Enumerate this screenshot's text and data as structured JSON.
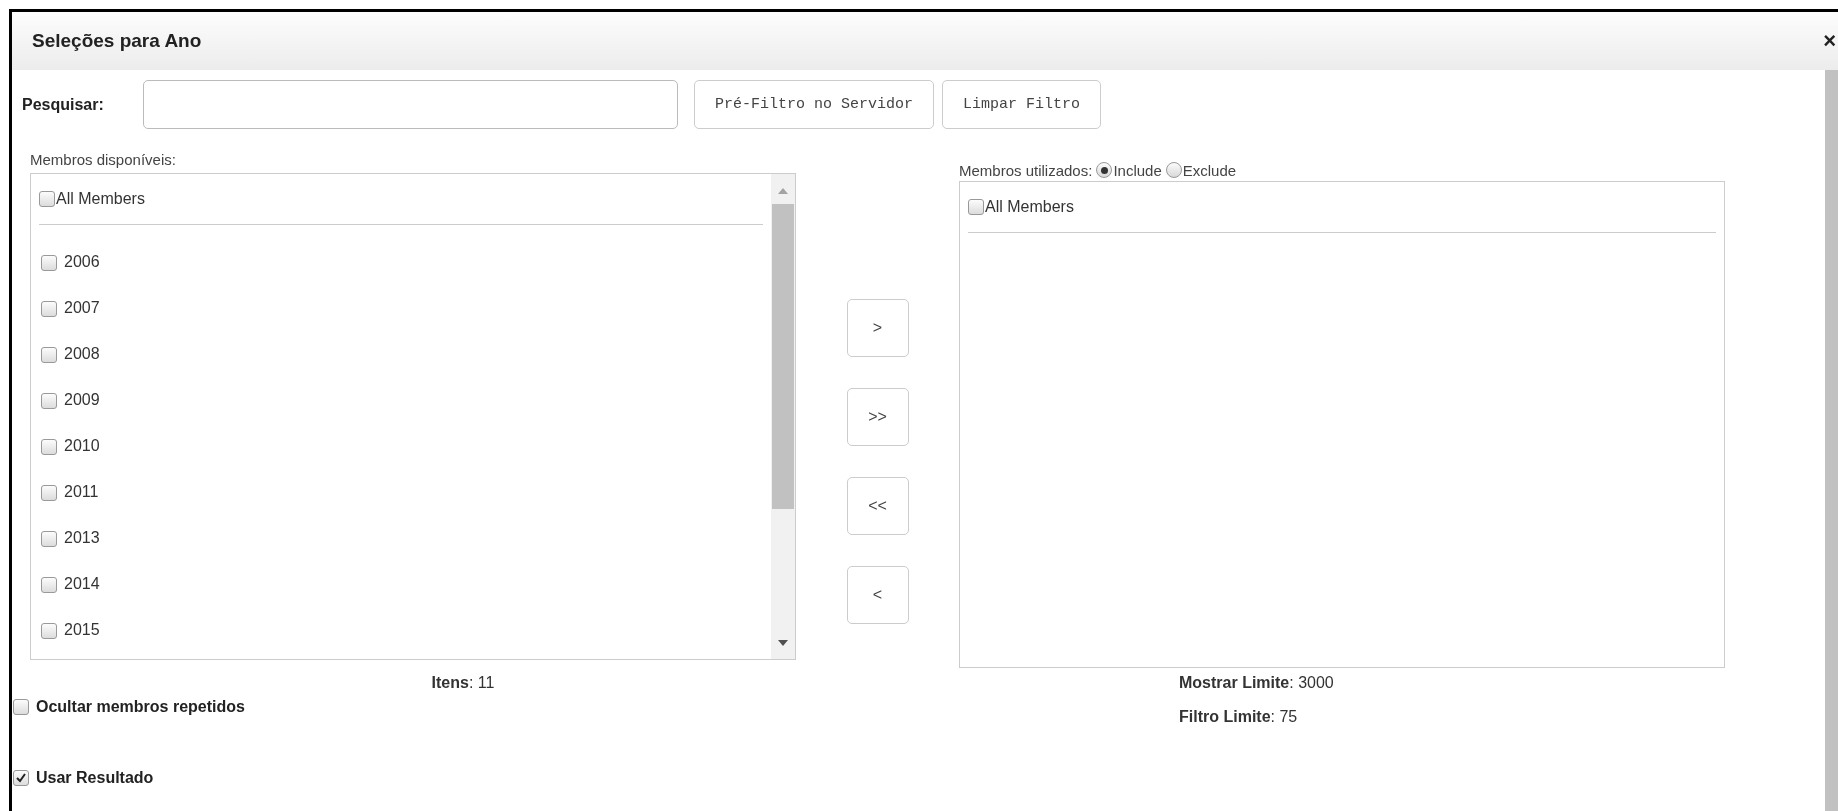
{
  "dialog": {
    "title": "Seleções para Ano",
    "close": "×"
  },
  "search": {
    "label": "Pesquisar:"
  },
  "filter_buttons": [
    "Pré-Filtro no Servidor",
    "Limpar Filtro"
  ],
  "available": {
    "label": "Membros disponíveis:",
    "all_members": {
      "label": "All Members",
      "checked": false
    },
    "items": [
      {
        "label": "2006",
        "checked": false
      },
      {
        "label": "2007",
        "checked": false
      },
      {
        "label": "2008",
        "checked": false
      },
      {
        "label": "2009",
        "checked": false
      },
      {
        "label": "2010",
        "checked": false
      },
      {
        "label": "2011",
        "checked": false
      },
      {
        "label": "2013",
        "checked": false
      },
      {
        "label": "2014",
        "checked": false
      },
      {
        "label": "2015",
        "checked": false
      }
    ],
    "count": "**Itens**: 11"
  },
  "transfer_buttons": [
    ">",
    ">>",
    "<<",
    "<"
  ],
  "used": {
    "label": "Membros utilizados:",
    "modes": [
      {
        "label": "Include",
        "selected": true
      },
      {
        "label": "Exclude",
        "selected": false
      }
    ],
    "all_members": {
      "label": "All Members",
      "checked": false
    }
  },
  "limits": [
    "**Mostrar Limite**: 3000",
    "**Filtro Limite**: 75"
  ],
  "options": [
    {
      "label": "Ocultar membros repetidos",
      "checked": false
    },
    {
      "label": "Usar Resultado",
      "checked": true
    }
  ]
}
